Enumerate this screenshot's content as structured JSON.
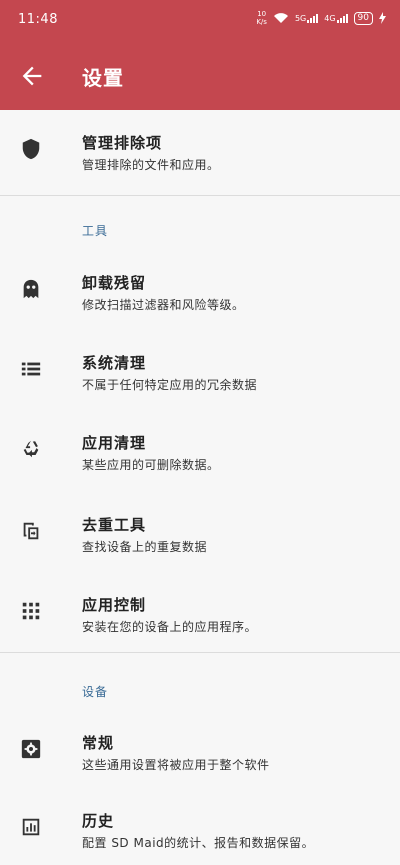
{
  "status": {
    "time": "11:48",
    "net_speed_top": "10",
    "net_speed_bottom": "K/s",
    "sig1": "5G",
    "sig2": "4G",
    "battery": "90"
  },
  "appbar": {
    "title": "设置"
  },
  "items": [
    {
      "title": "管理排除项",
      "subtitle": "管理排除的文件和应用。",
      "icon": "shield-icon"
    },
    {
      "title": "卸载残留",
      "subtitle": "修改扫描过滤器和风险等级。",
      "icon": "ghost-icon"
    },
    {
      "title": "系统清理",
      "subtitle": "不属于任何特定应用的冗余数据",
      "icon": "list-icon"
    },
    {
      "title": "应用清理",
      "subtitle": "某些应用的可删除数据。",
      "icon": "recycle-icon"
    },
    {
      "title": "去重工具",
      "subtitle": "查找设备上的重复数据",
      "icon": "duplicate-icon"
    },
    {
      "title": "应用控制",
      "subtitle": "安装在您的设备上的应用程序。",
      "icon": "apps-grid-icon"
    },
    {
      "title": "常规",
      "subtitle": "这些通用设置将被应用于整个软件",
      "icon": "gear-icon"
    },
    {
      "title": "历史",
      "subtitle": "配置 SD Maid的统计、报告和数据保留。",
      "icon": "chart-icon"
    }
  ],
  "sections": {
    "tools": "工具",
    "device": "设备"
  },
  "colors": {
    "toolbar": "#c4474f",
    "section": "#3a6b96",
    "background": "#f7f7f7"
  }
}
